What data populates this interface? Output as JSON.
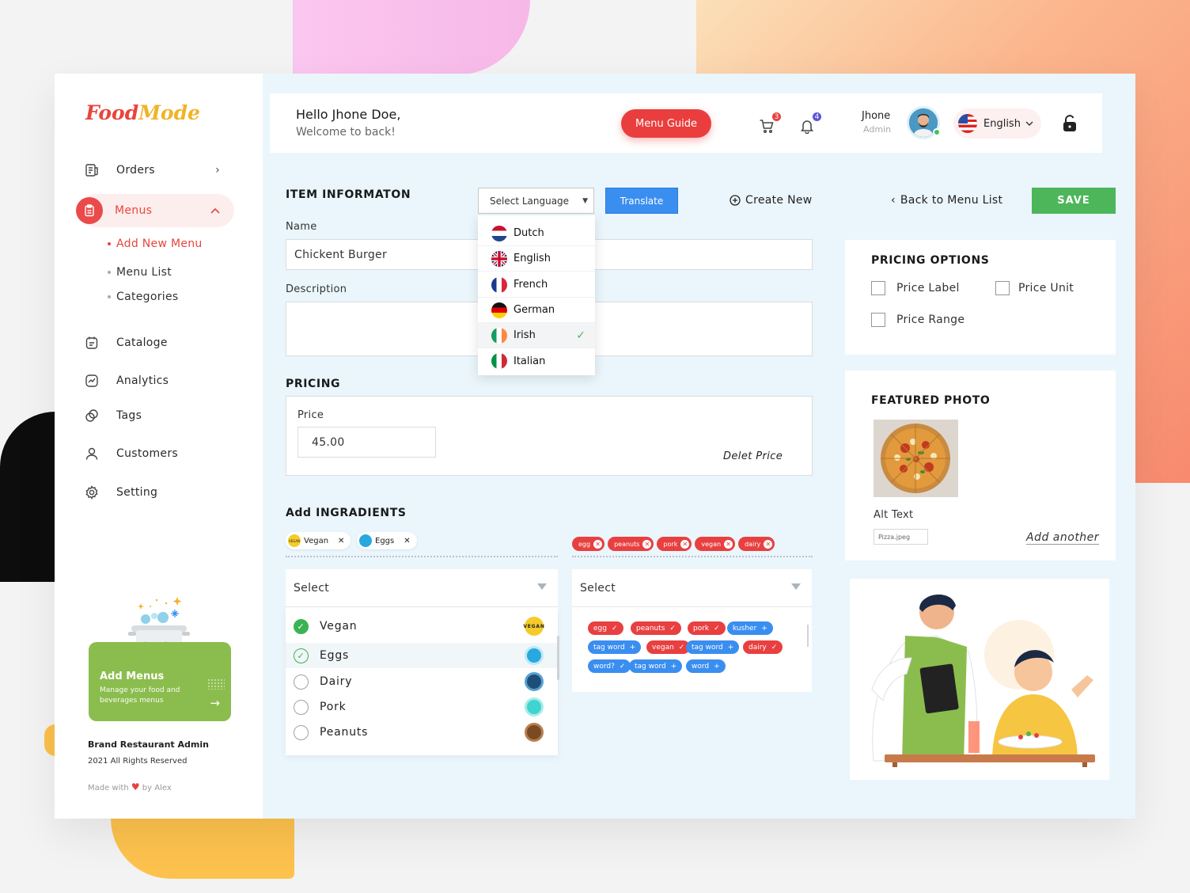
{
  "brand": {
    "name_part1": "Food",
    "name_part2": "Mode"
  },
  "sidebar": {
    "items": [
      {
        "label": "Orders",
        "icon": "orders-icon"
      },
      {
        "label": "Menus",
        "icon": "clipboard-icon"
      },
      {
        "label": "Cataloge",
        "icon": "catalog-icon"
      },
      {
        "label": "Analytics",
        "icon": "analytics-icon"
      },
      {
        "label": "Tags",
        "icon": "tags-icon"
      },
      {
        "label": "Customers",
        "icon": "user-icon"
      },
      {
        "label": "Setting",
        "icon": "gear-icon"
      }
    ],
    "submenu": [
      "Add New Menu",
      "Menu List",
      "Categories"
    ],
    "promo": {
      "title": "Add Menus",
      "subtitle": "Manage your food and beverages menus"
    },
    "footer": {
      "company": "Brand Restaurant Admin",
      "rights": "2021 All Rights Reserved",
      "made_prefix": "Made with",
      "made_suffix": "by Alex"
    }
  },
  "header": {
    "greeting": "Hello Jhone Doe,",
    "welcome": "Welcome to back!",
    "menu_guide": "Menu Guide",
    "cart_count": "3",
    "notif_count": "4",
    "user_name": "Jhone",
    "user_role": "Admin",
    "language": "English"
  },
  "toolbar": {
    "section_title": "ITEM INFORMATON",
    "select_language": "Select Language",
    "translate": "Translate",
    "create_new": "Create New",
    "back": "Back to Menu List",
    "save": "SAVE"
  },
  "languages": [
    {
      "name": "Dutch",
      "selected": false
    },
    {
      "name": "English",
      "selected": false
    },
    {
      "name": "French",
      "selected": false
    },
    {
      "name": "German",
      "selected": false
    },
    {
      "name": "Irish",
      "selected": true
    },
    {
      "name": "Italian",
      "selected": false
    }
  ],
  "form": {
    "name_label": "Name",
    "name_value": "Chickent Burger",
    "description_label": "Description",
    "description_value": "",
    "pricing_title": "PRICING",
    "price_label": "Price",
    "price_value": "45.00",
    "delete_price": "Delet Price"
  },
  "ingredients": {
    "title": "Add INGRADIENTS",
    "selected_chips": [
      "Vegan",
      "Eggs"
    ],
    "red_chips": [
      "egg",
      "peanuts",
      "pork",
      "vegan",
      "dairy"
    ],
    "select_placeholder_left": "Select",
    "select_placeholder_right": "Select",
    "options": [
      {
        "name": "Vegan",
        "state": "checked"
      },
      {
        "name": "Eggs",
        "state": "outlined"
      },
      {
        "name": "Dairy",
        "state": "empty"
      },
      {
        "name": "Pork",
        "state": "empty"
      },
      {
        "name": "Peanuts",
        "state": "empty"
      }
    ],
    "vegan_badge": "VEGAN",
    "tags": [
      {
        "label": "egg",
        "color": "red",
        "mark": "✓"
      },
      {
        "label": "peanuts",
        "color": "red",
        "mark": "✓"
      },
      {
        "label": "pork",
        "color": "red",
        "mark": "✓"
      },
      {
        "label": "kusher",
        "color": "blue",
        "mark": "+"
      },
      {
        "label": "tag word",
        "color": "blue",
        "mark": "+"
      },
      {
        "label": "vegan",
        "color": "red",
        "mark": "✓"
      },
      {
        "label": "tag word",
        "color": "blue",
        "mark": "+"
      },
      {
        "label": "dairy",
        "color": "red",
        "mark": "✓"
      },
      {
        "label": "word?",
        "color": "blue",
        "mark": "✓"
      },
      {
        "label": "tag word",
        "color": "blue",
        "mark": "+"
      },
      {
        "label": "word",
        "color": "blue",
        "mark": "+"
      }
    ]
  },
  "pricing_options": {
    "title": "PRICING OPTIONS",
    "options": [
      "Price Label",
      "Price Unit",
      "Price Range"
    ]
  },
  "featured_photo": {
    "title": "FEATURED PHOTO",
    "alt_label": "Alt Text",
    "alt_value": "Pizza.jpeg",
    "add_another": "Add another"
  },
  "colors": {
    "accent_red": "#e8453c",
    "green": "#4db65a",
    "blue": "#3a8ef0",
    "bg": "#eaf6fb"
  }
}
